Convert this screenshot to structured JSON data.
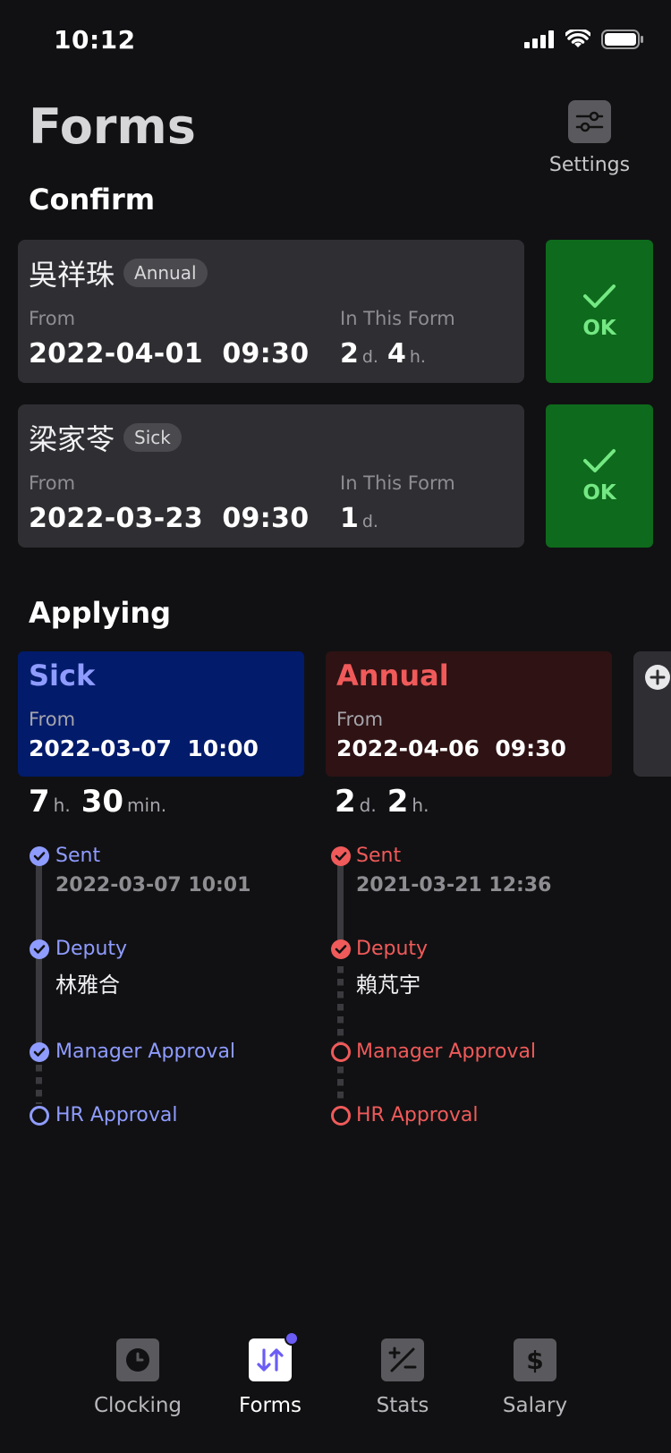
{
  "status_bar": {
    "time": "10:12"
  },
  "header": {
    "title": "Forms",
    "settings_label": "Settings"
  },
  "confirm": {
    "section_title": "Confirm",
    "from_label": "From",
    "in_form_label": "In This Form",
    "ok_label": "OK",
    "items": [
      {
        "name": "吳祥珠",
        "type": "Annual",
        "date": "2022-04-01  09:30",
        "d": "2",
        "d_unit": "d.",
        "h": "4",
        "h_unit": "h."
      },
      {
        "name": "梁家苓",
        "type": "Sick",
        "date": "2022-03-23  09:30",
        "d": "1",
        "d_unit": "d."
      }
    ]
  },
  "applying": {
    "section_title": "Applying",
    "from_label": "From",
    "forms": [
      {
        "type": "Sick",
        "date": "2022-03-07  10:00",
        "dur_a": "7",
        "unit_a": "h.",
        "dur_b": "30",
        "unit_b": "min.",
        "steps": [
          {
            "label": "Sent",
            "detail": "2022-03-07 10:01",
            "done": true
          },
          {
            "label": "Deputy",
            "detail": "林雅合",
            "done": true
          },
          {
            "label": "Manager Approval",
            "done": true
          },
          {
            "label": "HR Approval",
            "done": false
          }
        ],
        "colors": {
          "card": "#021b6b",
          "title": "#8f9cff",
          "accent": "#8f9cff"
        }
      },
      {
        "type": "Annual",
        "date": "2022-04-06  09:30",
        "dur_a": "2",
        "unit_a": "d.",
        "dur_b": "2",
        "unit_b": "h.",
        "steps": [
          {
            "label": "Sent",
            "detail": "2021-03-21 12:36",
            "done": true
          },
          {
            "label": "Deputy",
            "detail": "賴芃宇",
            "done": true
          },
          {
            "label": "Manager Approval",
            "done": false
          },
          {
            "label": "HR Approval",
            "done": false
          }
        ],
        "colors": {
          "card": "#2e1214",
          "title": "#f05a5a",
          "accent": "#f05a5a"
        }
      }
    ]
  },
  "tabbar": {
    "tabs": [
      {
        "label": "Clocking",
        "icon": "clock-icon"
      },
      {
        "label": "Forms",
        "icon": "swap-arrows-icon",
        "active": true
      },
      {
        "label": "Stats",
        "icon": "plus-minus-icon"
      },
      {
        "label": "Salary",
        "icon": "dollar-icon"
      }
    ]
  },
  "colors": {
    "ok_bg": "#0e6a1c",
    "ok_text": "#74e883",
    "badge": "#6b5cf6"
  }
}
